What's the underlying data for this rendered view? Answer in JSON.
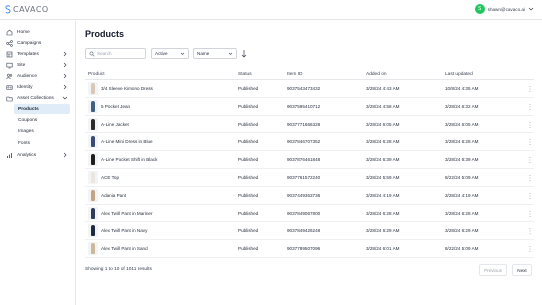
{
  "brand": {
    "name": "CAVACO"
  },
  "user": {
    "initial": "S",
    "email": "shawn@cavaco.ai"
  },
  "sidebar": {
    "items": [
      {
        "label": "Home",
        "icon": "home-icon"
      },
      {
        "label": "Campaigns",
        "icon": "campaigns-icon"
      },
      {
        "label": "Templates",
        "icon": "templates-icon",
        "chevron": "right"
      },
      {
        "label": "Site",
        "icon": "site-icon",
        "chevron": "right"
      },
      {
        "label": "Audience",
        "icon": "audience-icon",
        "chevron": "right"
      },
      {
        "label": "Identity",
        "icon": "identity-icon",
        "chevron": "right"
      },
      {
        "label": "Asset Collections",
        "icon": "asset-collections-icon",
        "chevron": "down"
      },
      {
        "label": "Products",
        "active": true
      },
      {
        "label": "Coupons"
      },
      {
        "label": "Images"
      },
      {
        "label": "Fonts"
      },
      {
        "label": "Analytics",
        "icon": "analytics-icon",
        "chevron": "right"
      }
    ]
  },
  "page": {
    "title": "Products"
  },
  "filters": {
    "search_placeholder": "Search",
    "status_value": "Active",
    "sort_value": "Name"
  },
  "table": {
    "columns": [
      "Product",
      "Status",
      "Item ID",
      "Added on",
      "Last updated"
    ],
    "rows": [
      {
        "product": "3/4 Sleeve Kimono Dress",
        "status": "Published",
        "item_id": "9037543473432",
        "added": "3/28/24 4:43 AM",
        "updated": "10/8/24 4:35 AM",
        "thumb_color": "#d9c7b8"
      },
      {
        "product": "5 Pocket Jean",
        "status": "Published",
        "item_id": "9037595410712",
        "added": "3/28/24 4:58 AM",
        "updated": "3/28/24 6:32 AM",
        "thumb_color": "#3f5f86"
      },
      {
        "product": "A-Line Jacket",
        "status": "Published",
        "item_id": "9037771666328",
        "added": "3/28/24 6:05 AM",
        "updated": "3/28/24 6:05 AM",
        "thumb_color": "#2b2b2b"
      },
      {
        "product": "A-Line Mini Dress in Blue",
        "status": "Published",
        "item_id": "9037846707352",
        "added": "3/28/24 6:28 AM",
        "updated": "3/28/24 6:28 AM",
        "thumb_color": "#3b4a78"
      },
      {
        "product": "A-Line Pocket Shift in Black",
        "status": "Published",
        "item_id": "9037876461848",
        "added": "3/28/24 6:39 AM",
        "updated": "3/28/24 6:39 AM",
        "thumb_color": "#1f1f1f"
      },
      {
        "product": "ACE Top",
        "status": "Published",
        "item_id": "9037761572240",
        "added": "3/28/24 5:59 AM",
        "updated": "8/22/24 5:09 AM",
        "thumb_color": "#ebe6df"
      },
      {
        "product": "Adania Pant",
        "status": "Published",
        "item_id": "9037449363736",
        "added": "3/28/24 4:19 AM",
        "updated": "3/28/24 4:19 AM",
        "thumb_color": "#c4a484"
      },
      {
        "product": "Alex Twill Pant in Mariner",
        "status": "Published",
        "item_id": "9037849067800",
        "added": "3/28/24 6:28 AM",
        "updated": "3/28/24 6:28 AM",
        "thumb_color": "#2f3d5c"
      },
      {
        "product": "Alex Twill Pant in Navy",
        "status": "Published",
        "item_id": "9037849426248",
        "added": "3/28/24 6:29 AM",
        "updated": "3/28/24 6:29 AM",
        "thumb_color": "#1e2a44"
      },
      {
        "product": "Alex Twill Pant in Sand",
        "status": "Published",
        "item_id": "9037789507096",
        "added": "3/28/24 6:01 AM",
        "updated": "8/22/24 5:09 AM",
        "thumb_color": "#cdb89a"
      }
    ]
  },
  "pagination": {
    "summary": "Showing 1 to 10 of 1011 results",
    "previous_label": "Previous",
    "next_label": "Next"
  }
}
